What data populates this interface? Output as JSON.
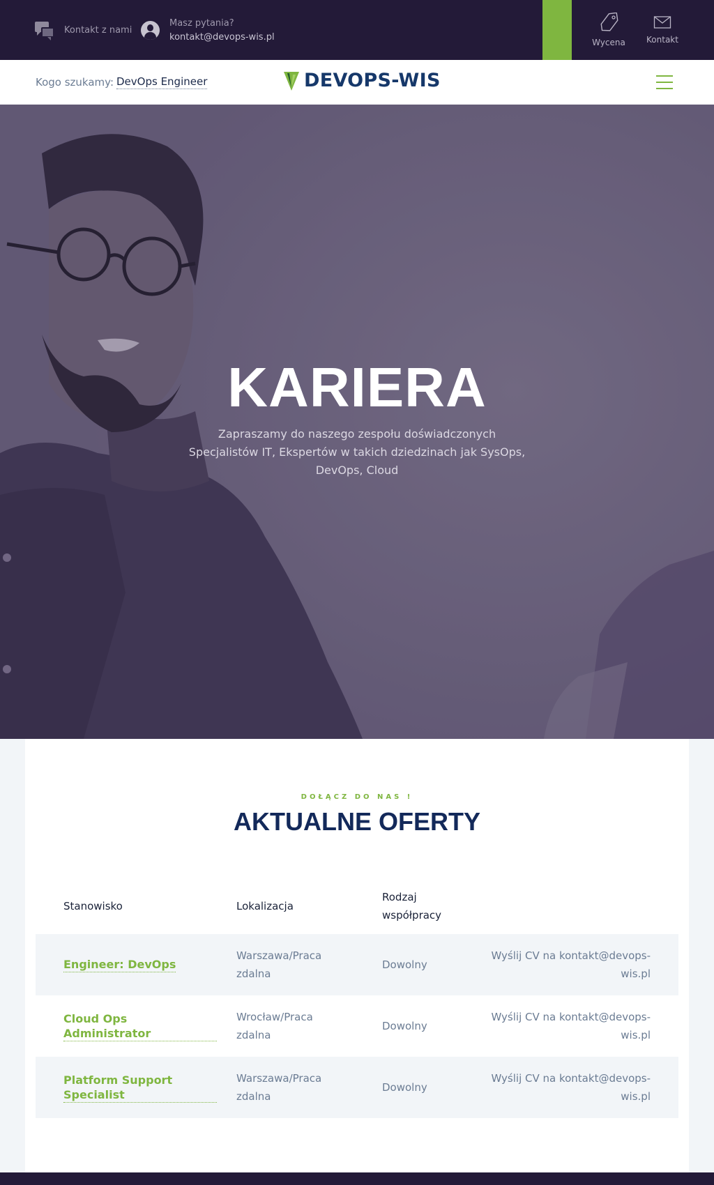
{
  "topbar": {
    "contact_label": "Kontakt z nami",
    "question_label": "Masz pytania?",
    "email": "kontakt@devops-wis.pl",
    "wycena_label": "Wycena",
    "kontakt_label": "Kontakt"
  },
  "nav": {
    "search_label": "Kogo szukamy:",
    "search_role": "DevOps Engineer",
    "logo_text": "DEVOPS-WIS"
  },
  "hero": {
    "title": "KARIERA",
    "subtitle": "Zapraszamy do naszego zespołu doświadczonych Specjalistów IT, Ekspertów w takich dziedzinach jak SysOps, DevOps, Cloud"
  },
  "offers": {
    "kicker": "DOŁĄCZ DO NAS !",
    "heading": "AKTUALNE OFERTY",
    "columns": {
      "position": "Stanowisko",
      "location": "Lokalizacja",
      "type": "Rodzaj współpracy"
    },
    "rows": [
      {
        "title": "Engineer: DevOps",
        "location": "Warszawa/Praca zdalna",
        "type": "Dowolny",
        "apply": "Wyślij CV na kontakt@devops-wis.pl"
      },
      {
        "title": "Cloud Ops Administrator",
        "location": "Wrocław/Praca zdalna",
        "type": "Dowolny",
        "apply": "Wyślij CV na kontakt@devops-wis.pl"
      },
      {
        "title": "Platform Support Specialist",
        "location": "Warszawa/Praca zdalna",
        "type": "Dowolny",
        "apply": "Wyślij CV na kontakt@devops-wis.pl"
      }
    ]
  },
  "colors": {
    "dark": "#231a38",
    "accent": "#7fb640",
    "navy": "#13295a"
  },
  "icons": [
    "chat-bubbles-icon",
    "user-avatar-icon",
    "price-tag-icon",
    "envelope-icon",
    "logo-leaf-icon",
    "hamburger-menu-icon"
  ]
}
